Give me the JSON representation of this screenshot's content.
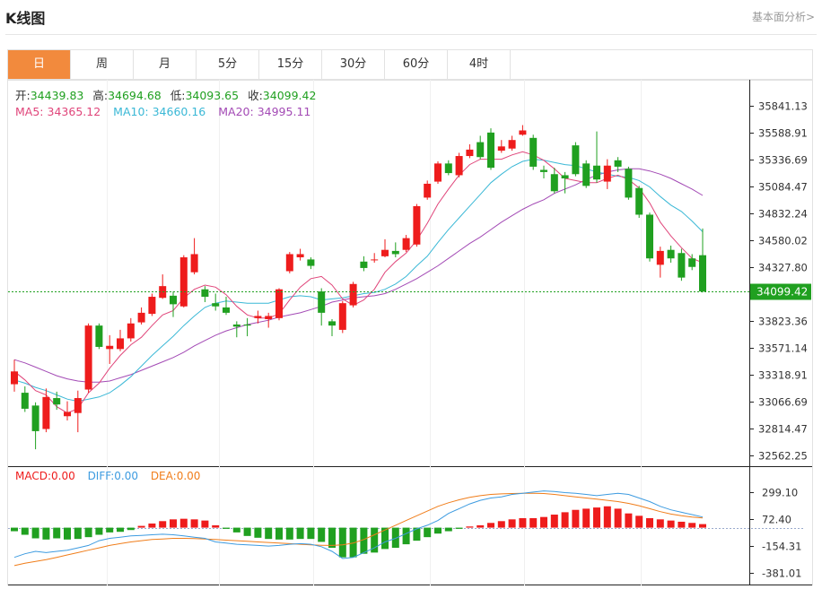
{
  "header": {
    "title": "K线图",
    "more_link": "基本面分析>"
  },
  "tabs": [
    {
      "label": "日",
      "active": true
    },
    {
      "label": "周"
    },
    {
      "label": "月"
    },
    {
      "label": "5分"
    },
    {
      "label": "15分"
    },
    {
      "label": "30分"
    },
    {
      "label": "60分"
    },
    {
      "label": "4时"
    }
  ],
  "ohlc_info": {
    "open_label": "开:",
    "open": "34439.83",
    "high_label": "高:",
    "high": "34694.68",
    "low_label": "低:",
    "low": "34093.65",
    "close_label": "收:",
    "close": "34099.42"
  },
  "ma_info": {
    "ma5_label": "MA5:",
    "ma5": "34365.12",
    "ma10_label": "MA10:",
    "ma10": "34660.16",
    "ma20_label": "MA20:",
    "ma20": "34995.11"
  },
  "macd_info": {
    "macd_label": "MACD:",
    "macd": "0.00",
    "diff_label": "DIFF:",
    "diff": "0.00",
    "dea_label": "DEA:",
    "dea": "0.00"
  },
  "colors": {
    "up": "#ee1c1c",
    "down": "#20a020",
    "ma5": "#e0457a",
    "ma10": "#3ab8d6",
    "ma20": "#a34ab5",
    "diff": "#3d9be0",
    "dea": "#f07d1a",
    "tab_active": "#f28a3d"
  },
  "chart_data": {
    "type": "candlestick",
    "y_ticks": [
      35841.13,
      35588.91,
      35336.69,
      35084.47,
      34832.24,
      34580.02,
      34327.8,
      33823.36,
      33571.14,
      33318.91,
      33066.69,
      32814.47,
      32562.25
    ],
    "y_tick_labels": [
      "35841.13",
      "35588.91",
      "35336.69",
      "35084.47",
      "34832.24",
      "34580.02",
      "34327.80",
      "33823.36",
      "33571.14",
      "33318.91",
      "33066.69",
      "32814.47",
      "32562.25"
    ],
    "ylim": [
      32562.25,
      35841.13
    ],
    "last_price_label": "34099.42",
    "last_price": 34099.42,
    "candles": [
      [
        33230,
        33350,
        33460,
        33160
      ],
      [
        33150,
        33000,
        33210,
        32970
      ],
      [
        33030,
        32790,
        33060,
        32620
      ],
      [
        32810,
        33110,
        33190,
        32780
      ],
      [
        33100,
        33040,
        33160,
        32990
      ],
      [
        32930,
        32970,
        33070,
        32890
      ],
      [
        32960,
        33100,
        33170,
        32780
      ],
      [
        33180,
        33780,
        33800,
        33150
      ],
      [
        33780,
        33580,
        33800,
        33560
      ],
      [
        33560,
        33590,
        33690,
        33420
      ],
      [
        33560,
        33660,
        33740,
        33540
      ],
      [
        33660,
        33800,
        33850,
        33630
      ],
      [
        33810,
        33900,
        33950,
        33790
      ],
      [
        33890,
        34050,
        34080,
        33870
      ],
      [
        34040,
        34150,
        34260,
        34030
      ],
      [
        34060,
        33980,
        34100,
        33860
      ],
      [
        33960,
        34420,
        34440,
        33950
      ],
      [
        34280,
        34450,
        34600,
        34260
      ],
      [
        34120,
        34050,
        34150,
        34000
      ],
      [
        33990,
        33960,
        34080,
        33920
      ],
      [
        33950,
        33900,
        34050,
        33880
      ],
      [
        33790,
        33770,
        33820,
        33670
      ],
      [
        33790,
        33780,
        33850,
        33680
      ],
      [
        33850,
        33870,
        33920,
        33800
      ],
      [
        33840,
        33870,
        33900,
        33760
      ],
      [
        33850,
        34120,
        34130,
        33830
      ],
      [
        34290,
        34450,
        34470,
        34270
      ],
      [
        34420,
        34450,
        34500,
        34390
      ],
      [
        34400,
        34340,
        34420,
        34310
      ],
      [
        34100,
        33900,
        34130,
        33780
      ],
      [
        33820,
        33780,
        33840,
        33680
      ],
      [
        33740,
        33990,
        34010,
        33710
      ],
      [
        33970,
        34170,
        34190,
        33950
      ],
      [
        34380,
        34320,
        34430,
        34290
      ],
      [
        34400,
        34400,
        34460,
        34370
      ],
      [
        34430,
        34490,
        34590,
        34420
      ],
      [
        34480,
        34450,
        34560,
        34420
      ],
      [
        34490,
        34600,
        34630,
        34470
      ],
      [
        34540,
        34900,
        34920,
        34520
      ],
      [
        34980,
        35110,
        35140,
        34960
      ],
      [
        35130,
        35300,
        35320,
        35110
      ],
      [
        35300,
        35210,
        35330,
        35190
      ],
      [
        35190,
        35370,
        35400,
        35170
      ],
      [
        35370,
        35430,
        35480,
        35350
      ],
      [
        35500,
        35360,
        35560,
        35340
      ],
      [
        35590,
        35260,
        35630,
        35240
      ],
      [
        35420,
        35460,
        35520,
        35400
      ],
      [
        35440,
        35520,
        35560,
        35420
      ],
      [
        35570,
        35610,
        35660,
        35560
      ],
      [
        35540,
        35270,
        35570,
        35240
      ],
      [
        35240,
        35220,
        35280,
        35160
      ],
      [
        35200,
        35040,
        35260,
        35020
      ],
      [
        35190,
        35160,
        35220,
        35020
      ],
      [
        35470,
        35200,
        35500,
        35180
      ],
      [
        35300,
        35090,
        35330,
        35070
      ],
      [
        35280,
        35150,
        35600,
        35120
      ],
      [
        35130,
        35280,
        35340,
        35060
      ],
      [
        35330,
        35270,
        35360,
        35220
      ],
      [
        35250,
        34980,
        35270,
        34960
      ],
      [
        35070,
        34820,
        35090,
        34790
      ],
      [
        34820,
        34410,
        34840,
        34380
      ],
      [
        34350,
        34480,
        34520,
        34230
      ],
      [
        34490,
        34410,
        34530,
        34370
      ],
      [
        34460,
        34230,
        34500,
        34200
      ],
      [
        34410,
        34330,
        34450,
        34300
      ],
      [
        34440,
        34100,
        34690,
        34090
      ]
    ],
    "ma5": [
      33350,
      33270,
      33170,
      33130,
      33020,
      32960,
      33000,
      33150,
      33240,
      33380,
      33500,
      33600,
      33670,
      33780,
      33880,
      33920,
      34040,
      34120,
      34160,
      34140,
      34070,
      33960,
      33880,
      33850,
      33850,
      33890,
      34020,
      34140,
      34220,
      34240,
      34160,
      34030,
      33970,
      34020,
      34120,
      34280,
      34380,
      34460,
      34580,
      34740,
      34920,
      35060,
      35190,
      35290,
      35340,
      35340,
      35340,
      35380,
      35410,
      35380,
      35330,
      35250,
      35160,
      35140,
      35120,
      35120,
      35160,
      35190,
      35150,
      35070,
      34930,
      34750,
      34620,
      34510,
      34410,
      34370
    ],
    "ma10": [
      33270,
      33240,
      33200,
      33170,
      33130,
      33090,
      33070,
      33090,
      33110,
      33150,
      33220,
      33300,
      33400,
      33500,
      33590,
      33680,
      33780,
      33870,
      33950,
      33990,
      34010,
      34000,
      33990,
      33990,
      33990,
      34020,
      34050,
      34060,
      34050,
      34020,
      34030,
      34040,
      34060,
      34080,
      34090,
      34120,
      34170,
      34240,
      34340,
      34430,
      34560,
      34680,
      34790,
      34900,
      35010,
      35120,
      35200,
      35270,
      35320,
      35340,
      35330,
      35310,
      35290,
      35280,
      35250,
      35220,
      35200,
      35180,
      35170,
      35140,
      35080,
      34990,
      34910,
      34850,
      34760,
      34660
    ],
    "ma20": [
      33460,
      33430,
      33390,
      33350,
      33310,
      33280,
      33260,
      33250,
      33250,
      33260,
      33290,
      33320,
      33360,
      33400,
      33440,
      33480,
      33530,
      33590,
      33640,
      33690,
      33730,
      33760,
      33790,
      33810,
      33830,
      33860,
      33880,
      33900,
      33930,
      33960,
      34000,
      34020,
      34040,
      34050,
      34060,
      34080,
      34120,
      34170,
      34220,
      34280,
      34340,
      34410,
      34480,
      34550,
      34610,
      34680,
      34750,
      34810,
      34870,
      34920,
      34960,
      35020,
      35060,
      35100,
      35150,
      35190,
      35220,
      35240,
      35250,
      35250,
      35230,
      35200,
      35160,
      35110,
      35060,
      35000
    ],
    "macd_y_ticks": [
      299.1,
      72.4,
      -154.31,
      -381.01
    ],
    "macd_y_tick_labels": [
      "299.10",
      "72.40",
      "-154.31",
      "-381.01"
    ],
    "macd_ylim": [
      -381.01,
      299.1
    ],
    "macd_hist": [
      -30,
      -60,
      -90,
      -100,
      -90,
      -100,
      -95,
      -80,
      -60,
      -40,
      -35,
      -20,
      15,
      35,
      55,
      70,
      75,
      70,
      60,
      20,
      -10,
      -40,
      -70,
      -85,
      -95,
      -100,
      -100,
      -95,
      -95,
      -120,
      -170,
      -250,
      -250,
      -220,
      -210,
      -180,
      -170,
      -140,
      -110,
      -80,
      -50,
      -30,
      -10,
      10,
      20,
      40,
      55,
      70,
      80,
      80,
      90,
      110,
      130,
      150,
      160,
      170,
      180,
      160,
      120,
      100,
      80,
      70,
      60,
      50,
      40,
      30
    ],
    "macd_diff": [
      -250,
      -220,
      -200,
      -210,
      -200,
      -190,
      -170,
      -150,
      -110,
      -90,
      -80,
      -70,
      -65,
      -60,
      -55,
      -60,
      -70,
      -80,
      -90,
      -120,
      -130,
      -140,
      -145,
      -150,
      -155,
      -150,
      -140,
      -135,
      -140,
      -160,
      -200,
      -260,
      -250,
      -210,
      -170,
      -120,
      -90,
      -50,
      -10,
      20,
      60,
      120,
      160,
      200,
      230,
      250,
      260,
      280,
      290,
      300,
      310,
      305,
      295,
      290,
      280,
      270,
      280,
      290,
      280,
      250,
      220,
      180,
      150,
      130,
      110,
      90
    ],
    "macd_dea": [
      -320,
      -300,
      -285,
      -270,
      -250,
      -230,
      -210,
      -190,
      -170,
      -150,
      -135,
      -120,
      -110,
      -100,
      -95,
      -90,
      -90,
      -92,
      -95,
      -100,
      -105,
      -110,
      -115,
      -120,
      -125,
      -130,
      -135,
      -140,
      -145,
      -148,
      -150,
      -145,
      -130,
      -100,
      -60,
      -20,
      20,
      60,
      100,
      140,
      180,
      210,
      235,
      255,
      270,
      280,
      285,
      288,
      290,
      290,
      288,
      280,
      270,
      260,
      250,
      240,
      230,
      220,
      205,
      185,
      160,
      135,
      115,
      100,
      90,
      82
    ]
  }
}
